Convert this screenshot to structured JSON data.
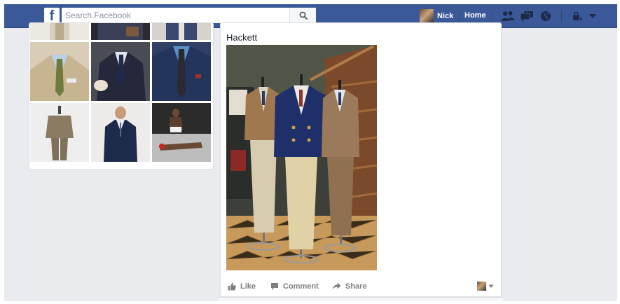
{
  "topbar": {
    "logo": "f",
    "search_placeholder": "Search Facebook",
    "user_name": "Nick",
    "home_label": "Home",
    "icons": [
      "friend-requests-icon",
      "messages-icon",
      "notifications-globe-icon",
      "privacy-lock-icon",
      "account-dropdown-icon"
    ]
  },
  "post": {
    "title": "Hackett",
    "like_label": "Like",
    "comment_label": "Comment",
    "share_label": "Share"
  },
  "colors": {
    "facebook_blue": "#3b5998",
    "page_background": "#e9ebee",
    "card_background": "#ffffff",
    "action_gray": "#7f7f7f"
  }
}
